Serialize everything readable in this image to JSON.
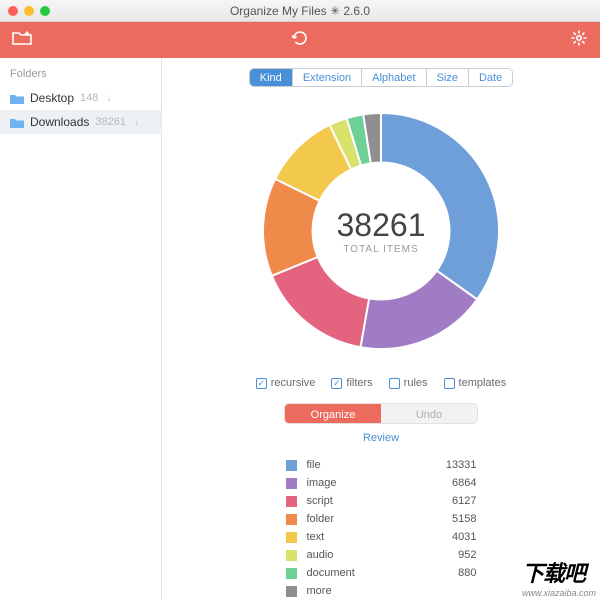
{
  "window": {
    "title": "Organize My Files ✳ 2.6.0"
  },
  "sidebar": {
    "header": "Folders",
    "items": [
      {
        "label": "Desktop",
        "count": "148"
      },
      {
        "label": "Downloads",
        "count": "38261"
      }
    ]
  },
  "tabs": [
    "Kind",
    "Extension",
    "Alphabet",
    "Size",
    "Date"
  ],
  "activeTab": 0,
  "total": {
    "value": "38261",
    "label": "TOTAL ITEMS"
  },
  "checks": [
    {
      "label": "recursive",
      "checked": true
    },
    {
      "label": "filters",
      "checked": true
    },
    {
      "label": "rules",
      "checked": false
    },
    {
      "label": "templates",
      "checked": false
    }
  ],
  "actions": {
    "primary": "Organize",
    "secondary": "Undo",
    "review": "Review"
  },
  "legend": [
    {
      "label": "file",
      "value": "13331",
      "color": "#6f9fd8"
    },
    {
      "label": "image",
      "value": "6864",
      "color": "#a07cc5"
    },
    {
      "label": "script",
      "value": "6127",
      "color": "#e4637e"
    },
    {
      "label": "folder",
      "value": "5158",
      "color": "#f08a4b"
    },
    {
      "label": "text",
      "value": "4031",
      "color": "#f2c94c"
    },
    {
      "label": "audio",
      "value": "952",
      "color": "#d8e26a"
    },
    {
      "label": "document",
      "value": "880",
      "color": "#6fcf97"
    },
    {
      "label": "more",
      "value": "",
      "color": "#8f8f8f"
    }
  ],
  "chart_data": {
    "type": "pie",
    "title": "",
    "series": [
      {
        "name": "file",
        "value": 13331,
        "color": "#6f9fd8"
      },
      {
        "name": "image",
        "value": 6864,
        "color": "#a07cc5"
      },
      {
        "name": "script",
        "value": 6127,
        "color": "#e4637e"
      },
      {
        "name": "folder",
        "value": 5158,
        "color": "#f08a4b"
      },
      {
        "name": "text",
        "value": 4031,
        "color": "#f2c94c"
      },
      {
        "name": "audio",
        "value": 952,
        "color": "#d8e26a"
      },
      {
        "name": "document",
        "value": 880,
        "color": "#6fcf97"
      },
      {
        "name": "more",
        "value": 918,
        "color": "#8f8f8f"
      }
    ],
    "total": 38261,
    "center_label": "TOTAL ITEMS",
    "inner_radius_ratio": 0.58
  },
  "watermark": {
    "big": "下载吧",
    "small": "www.xiazaiba.com"
  }
}
